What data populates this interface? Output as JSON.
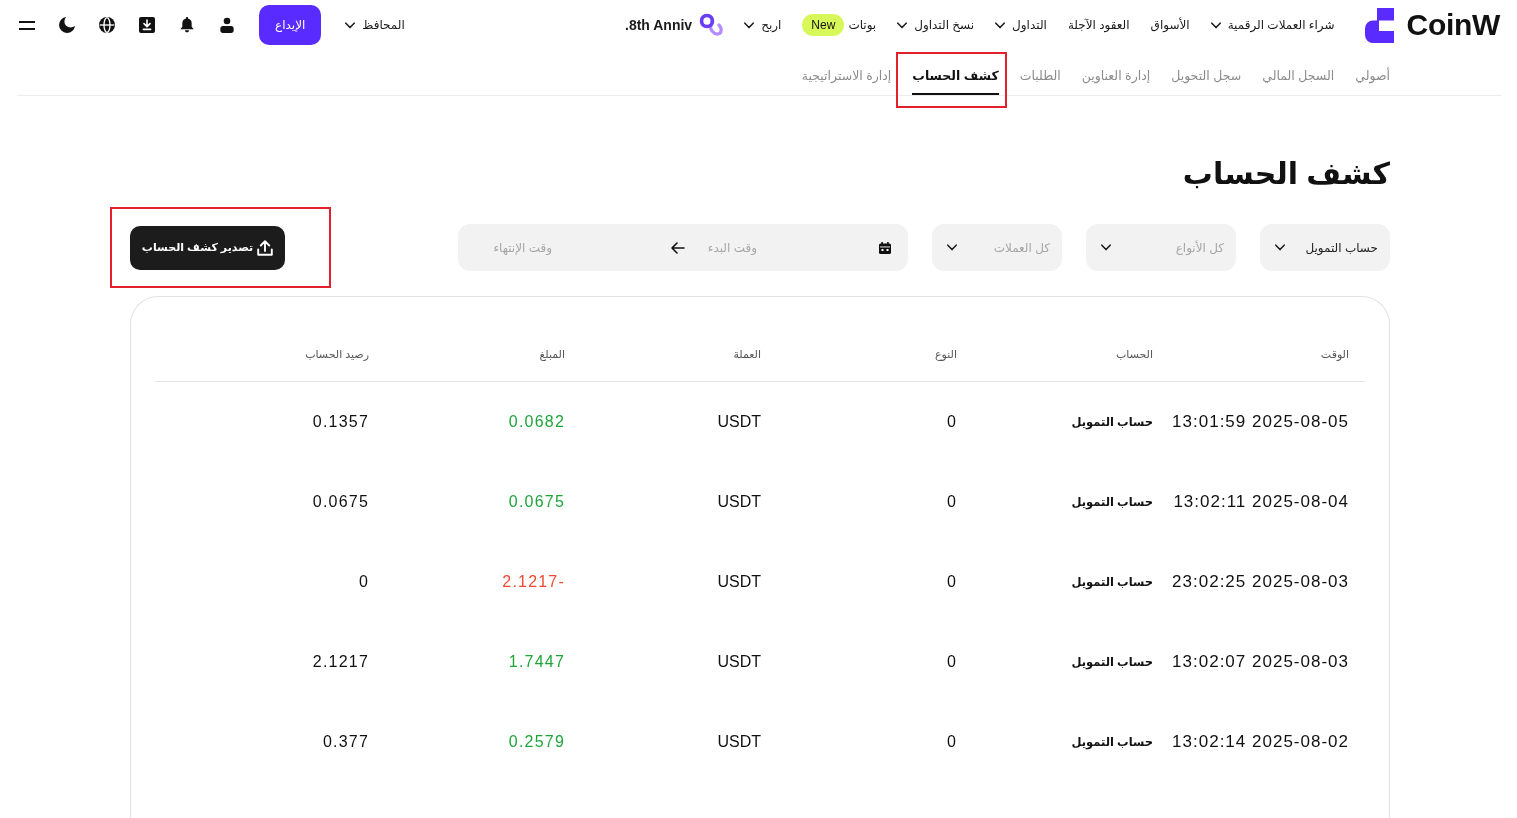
{
  "header": {
    "logo": {
      "text": "CoinW"
    },
    "nav": [
      {
        "label": "شراء العملات الرقمية",
        "dropdown": true
      },
      {
        "label": "الأسواق",
        "dropdown": false
      },
      {
        "label": "العقود الآجلة",
        "dropdown": false
      },
      {
        "label": "التداول",
        "dropdown": true
      },
      {
        "label": "نسخ التداول",
        "dropdown": true
      },
      {
        "label": "بوتات",
        "dropdown": false,
        "badge": "New"
      },
      {
        "label": "اربح",
        "dropdown": true
      }
    ],
    "promo": {
      "label": "8th Anniv."
    },
    "wallets": {
      "label": "المحافظ",
      "dropdown": true
    },
    "deposit_button": {
      "label": "الإيداع"
    }
  },
  "tabs": [
    {
      "label": "أصولي",
      "selected": false,
      "highlighted": false
    },
    {
      "label": "السجل المالي",
      "selected": false,
      "highlighted": false
    },
    {
      "label": "سجل التحويل",
      "selected": false,
      "highlighted": false
    },
    {
      "label": "إدارة العناوين",
      "selected": false,
      "highlighted": false
    },
    {
      "label": "الطلبات",
      "selected": false,
      "highlighted": false
    },
    {
      "label": "كشف الحساب",
      "selected": true,
      "highlighted": true
    },
    {
      "label": "إدارة الاستراتيجية",
      "selected": false,
      "highlighted": false
    }
  ],
  "title": "كشف الحساب",
  "filters": {
    "account": {
      "value": "حساب التمويل"
    },
    "type": {
      "placeholder": "كل الأنواع"
    },
    "currency": {
      "placeholder": "كل العملات"
    },
    "date_range": {
      "start": {
        "placeholder": "وقت البدء"
      },
      "end": {
        "placeholder": "وقت الإنتهاء"
      }
    }
  },
  "export_button": {
    "label": "تصدير كشف الحساب",
    "highlighted": true
  },
  "table": {
    "columns": [
      "الوقت",
      "الحساب",
      "النوع",
      "العملة",
      "المبلغ",
      "رصيد الحساب"
    ],
    "rows": [
      {
        "time": "2025-08-05 13:01:59",
        "account": "حساب التمويل",
        "type": "0",
        "currency": "USDT",
        "amount": "0.0682",
        "kind": "credit",
        "balance": "0.1357"
      },
      {
        "time": "2025-08-04 13:02:11",
        "account": "حساب التمويل",
        "type": "0",
        "currency": "USDT",
        "amount": "0.0675",
        "kind": "credit",
        "balance": "0.0675"
      },
      {
        "time": "2025-08-03 23:02:25",
        "account": "حساب التمويل",
        "type": "0",
        "currency": "USDT",
        "amount": "-2.1217",
        "kind": "debit",
        "balance": "0"
      },
      {
        "time": "2025-08-03 13:02:07",
        "account": "حساب التمويل",
        "type": "0",
        "currency": "USDT",
        "amount": "1.7447",
        "kind": "credit",
        "balance": "2.1217"
      },
      {
        "time": "2025-08-02 13:02:14",
        "account": "حساب التمويل",
        "type": "0",
        "currency": "USDT",
        "amount": "0.2579",
        "kind": "credit",
        "balance": "0.377"
      }
    ]
  }
}
